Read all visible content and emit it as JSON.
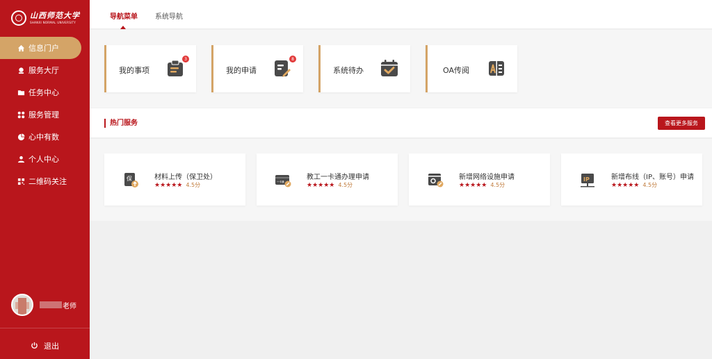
{
  "sidebar": {
    "logo_cn": "山西师范大学",
    "logo_en": "SHANXI NORMAL UNIVERSITY",
    "items": [
      {
        "label": "信息门户",
        "icon": "home-icon",
        "active": true
      },
      {
        "label": "服务大厅",
        "icon": "service-hall-icon"
      },
      {
        "label": "任务中心",
        "icon": "folder-icon"
      },
      {
        "label": "服务管理",
        "icon": "grid-icon"
      },
      {
        "label": "心中有数",
        "icon": "pie-chart-icon"
      },
      {
        "label": "个人中心",
        "icon": "user-icon"
      },
      {
        "label": "二维码关注",
        "icon": "qrcode-icon"
      }
    ],
    "user_name": "老师",
    "logout_label": "退出"
  },
  "tabs": [
    {
      "label": "导航菜单",
      "active": true
    },
    {
      "label": "系统导航",
      "active": false
    }
  ],
  "quick_cards": [
    {
      "label": "我的事项",
      "icon": "clipboard-icon",
      "badge": "3"
    },
    {
      "label": "我的申请",
      "icon": "edit-doc-icon",
      "badge": "8"
    },
    {
      "label": "系统待办",
      "icon": "calendar-check-icon",
      "badge": ""
    },
    {
      "label": "OA传阅",
      "icon": "book-icon",
      "badge": ""
    }
  ],
  "hot_services": {
    "title": "热门服务",
    "more_label": "查看更多服务",
    "items": [
      {
        "name": "材料上传（保卫处）",
        "stars": "★★★★★",
        "score": "4.5分",
        "icon": "upload-doc-icon",
        "icon_text": "保"
      },
      {
        "name": "教工一卡通办理申请",
        "stars": "★★★★★",
        "score": "4.5分",
        "icon": "card-icon",
        "icon_text": "一卡通"
      },
      {
        "name": "新增网络设施申请",
        "stars": "★★★★★",
        "score": "4.5分",
        "icon": "network-settings-icon",
        "icon_text": ""
      },
      {
        "name": "新增布线（IP、账号）申请",
        "stars": "★★★★★",
        "score": "4.5分",
        "icon": "ip-icon",
        "icon_text": "IP"
      }
    ]
  },
  "colors": {
    "primary": "#b9161c",
    "accent": "#d4a467",
    "badge": "#e23b3b",
    "icon_dark": "#4a4a4a"
  }
}
